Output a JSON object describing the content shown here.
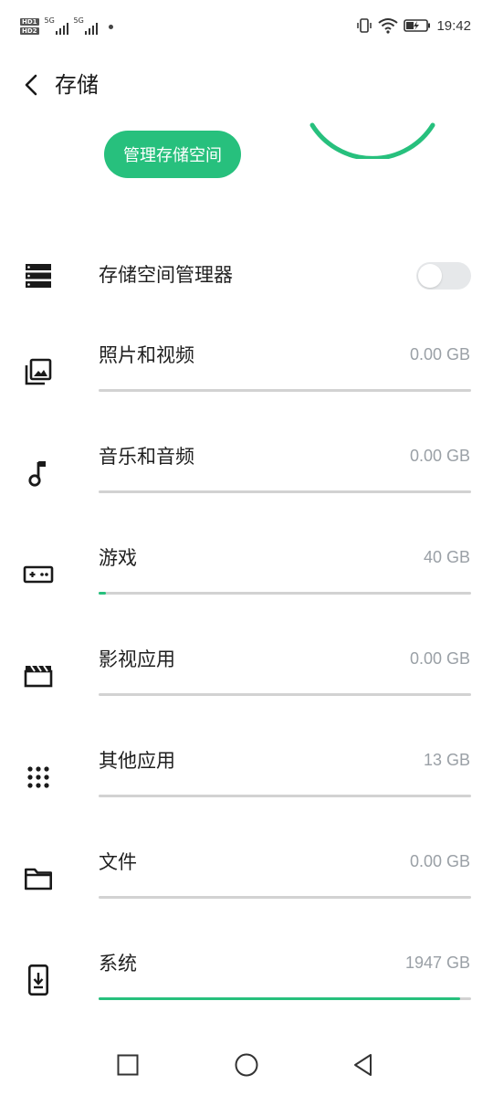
{
  "status_bar": {
    "sim1": "HD1",
    "sim2": "HD2",
    "net1": "5G",
    "net2": "5G",
    "time": "19:42"
  },
  "header": {
    "title": "存储"
  },
  "manage_button": "管理存储空间",
  "storage_manager": {
    "label": "存储空间管理器",
    "enabled": false
  },
  "categories": [
    {
      "label": "照片和视频",
      "size": "0.00 GB",
      "usage": 0.0,
      "icon": "photo-library-icon"
    },
    {
      "label": "音乐和音频",
      "size": "0.00 GB",
      "usage": 0.0,
      "icon": "music-note-icon"
    },
    {
      "label": "游戏",
      "size": "40 GB",
      "usage": 0.02,
      "icon": "gamepad-icon"
    },
    {
      "label": "影视应用",
      "size": "0.00 GB",
      "usage": 0.0,
      "icon": "clapperboard-icon"
    },
    {
      "label": "其他应用",
      "size": "13 GB",
      "usage": 0.0,
      "icon": "apps-grid-icon"
    },
    {
      "label": "文件",
      "size": "0.00 GB",
      "usage": 0.0,
      "icon": "folder-icon"
    },
    {
      "label": "系统",
      "size": "1947 GB",
      "usage": 0.97,
      "icon": "phone-download-icon"
    }
  ],
  "colors": {
    "accent": "#27c07d",
    "track": "#d2d2d2",
    "secondary_text": "#9aa0a6"
  }
}
